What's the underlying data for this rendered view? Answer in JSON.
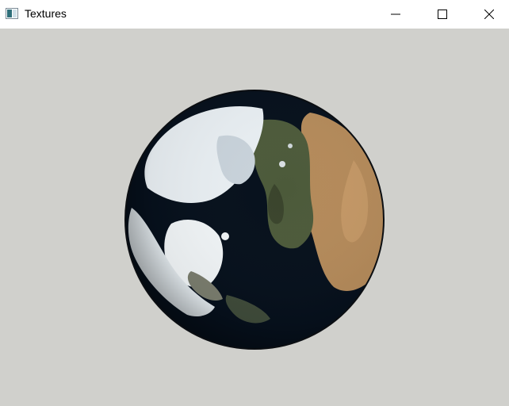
{
  "window": {
    "title": "Textures",
    "icon": "app-window-icon",
    "buttons": {
      "minimize": "minimize-icon",
      "maximize": "maximize-icon",
      "close": "close-icon"
    }
  },
  "viewport": {
    "background_color": "#d0d0cc",
    "content": "textured-earth-globe"
  },
  "colors": {
    "ocean": "#06101c",
    "desert": "#b48a5a",
    "ice": "#e8eef2",
    "land_green": "#4c5a3a"
  }
}
